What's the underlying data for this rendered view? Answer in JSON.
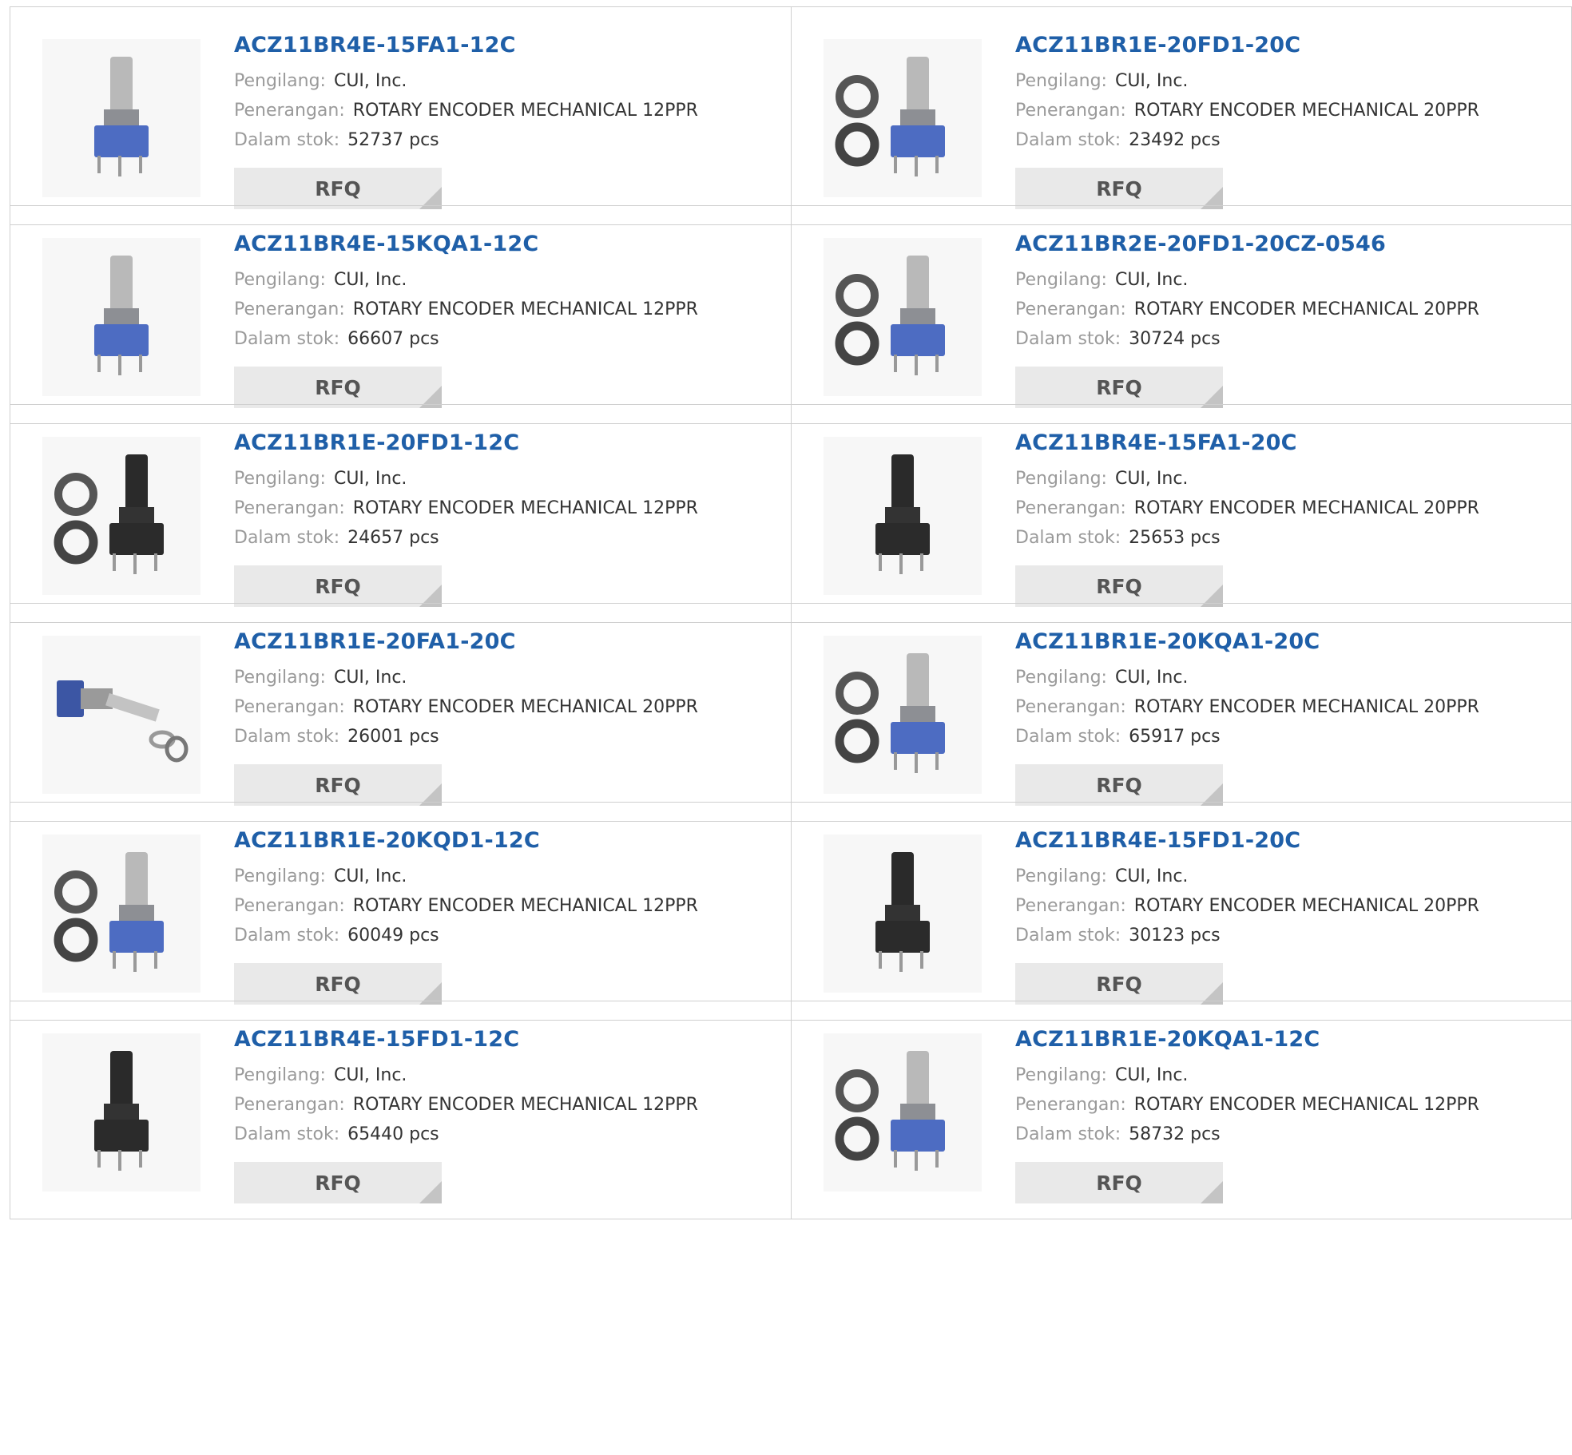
{
  "labels": {
    "manufacturer": "Pengilang:",
    "description": "Penerangan:",
    "stock": "Dalam stok:",
    "rfq": "RFQ"
  },
  "products": [
    {
      "part": "ACZ11BR4E-15FA1-12C",
      "manufacturer": "CUI, Inc.",
      "description": "ROTARY ENCODER MECHANICAL 12PPR",
      "stock": "52737 pcs",
      "image": "encoder-gray-small"
    },
    {
      "part": "ACZ11BR1E-20FD1-20C",
      "manufacturer": "CUI, Inc.",
      "description": "ROTARY ENCODER MECHANICAL 20PPR",
      "stock": "23492 pcs",
      "image": "encoder-with-nut-washer"
    },
    {
      "part": "ACZ11BR4E-15KQA1-12C",
      "manufacturer": "CUI, Inc.",
      "description": "ROTARY ENCODER MECHANICAL 12PPR",
      "stock": "66607 pcs",
      "image": "encoder-knurled-large"
    },
    {
      "part": "ACZ11BR2E-20FD1-20CZ-0546",
      "manufacturer": "CUI, Inc.",
      "description": "ROTARY ENCODER MECHANICAL 20PPR",
      "stock": "30724 pcs",
      "image": "encoder-silver-with-washers"
    },
    {
      "part": "ACZ11BR1E-20FD1-12C",
      "manufacturer": "CUI, Inc.",
      "description": "ROTARY ENCODER MECHANICAL 12PPR",
      "stock": "24657 pcs",
      "image": "encoder-black-with-nut-washer"
    },
    {
      "part": "ACZ11BR4E-15FA1-20C",
      "manufacturer": "CUI, Inc.",
      "description": "ROTARY ENCODER MECHANICAL 20PPR",
      "stock": "25653 pcs",
      "image": "encoder-black-large"
    },
    {
      "part": "ACZ11BR1E-20FA1-20C",
      "manufacturer": "CUI, Inc.",
      "description": "ROTARY ENCODER MECHANICAL 20PPR",
      "stock": "26001 pcs",
      "image": "encoder-horizontal-with-washers"
    },
    {
      "part": "ACZ11BR1E-20KQA1-20C",
      "manufacturer": "CUI, Inc.",
      "description": "ROTARY ENCODER MECHANICAL 20PPR",
      "stock": "65917 pcs",
      "image": "encoder-knurled-with-nut-washer"
    },
    {
      "part": "ACZ11BR1E-20KQD1-12C",
      "manufacturer": "CUI, Inc.",
      "description": "ROTARY ENCODER MECHANICAL 12PPR",
      "stock": "60049 pcs",
      "image": "encoder-knurled-with-nut-washer-left"
    },
    {
      "part": "ACZ11BR4E-15FD1-20C",
      "manufacturer": "CUI, Inc.",
      "description": "ROTARY ENCODER MECHANICAL 20PPR",
      "stock": "30123 pcs",
      "image": "encoder-dark-shaft"
    },
    {
      "part": "ACZ11BR4E-15FD1-12C",
      "manufacturer": "CUI, Inc.",
      "description": "ROTARY ENCODER MECHANICAL 12PPR",
      "stock": "65440 pcs",
      "image": "encoder-black-tall"
    },
    {
      "part": "ACZ11BR1E-20KQA1-12C",
      "manufacturer": "CUI, Inc.",
      "description": "ROTARY ENCODER MECHANICAL 12PPR",
      "stock": "58732 pcs",
      "image": "encoder-knurled-with-washer-nut"
    }
  ],
  "colors": {
    "part_link": "#1f5fa8",
    "label": "#9a9a9a",
    "value": "#333333",
    "rfq_bg": "#e9e9e9",
    "border": "#cfcfcf"
  }
}
